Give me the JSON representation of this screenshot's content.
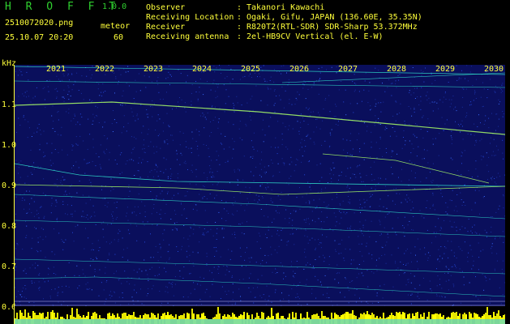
{
  "header": {
    "app_name": "H R O F F T",
    "version": "1.0.0",
    "filename": "2510072020.png",
    "datetime": "25.10.07 20:20",
    "meteor_label": "meteor",
    "meteor_count": "60",
    "info": [
      {
        "label": "Observer",
        "value": "Takanori Kawachi"
      },
      {
        "label": "Receiving Location",
        "value": "Ogaki, Gifu, JAPAN (136.60E, 35.35N)"
      },
      {
        "label": "Receiver",
        "value": "R820T2(RTL-SDR) SDR-Sharp 53.372MHz"
      },
      {
        "label": "Receiving antenna",
        "value": "2el-HB9CV Vertical (el. E-W)"
      }
    ],
    "separator": ":"
  },
  "axes": {
    "y_unit": "kHz",
    "y_ticks": [
      "1.1",
      "1.0",
      "0.9",
      "0.8",
      "0.7",
      "0.6"
    ],
    "x_ticks": [
      "2021",
      "2022",
      "2023",
      "2024",
      "2025",
      "2026",
      "2027",
      "2028",
      "2029",
      "2030"
    ]
  },
  "colors": {
    "text": "#ffff3a",
    "title": "#2fd02f",
    "background": "#0a0f5c",
    "trace": "#33e8d0",
    "bright_trace": "#aaff66",
    "bar": "#ffff00"
  }
}
